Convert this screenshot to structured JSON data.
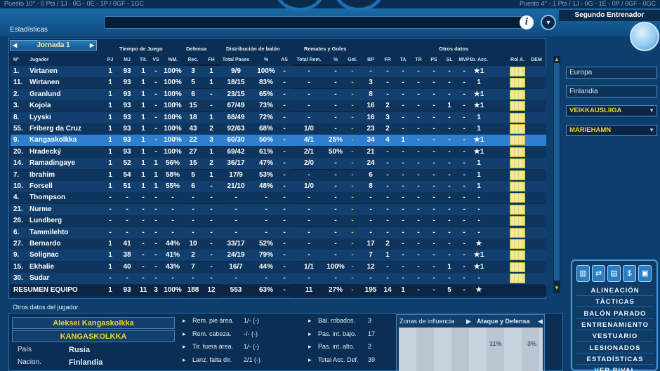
{
  "top_strip": {
    "left": "Puesto 10° - 0 Pts / 1J - 0G - 0E - 1P / 0GF - 1GC",
    "right": "Puesto 4° - 1 Pts / 1J - 0G - 1E - 0P / 0GF - 0GC"
  },
  "header": {
    "section_title": "Estadísticas",
    "assistant_label": "Segundo Entrenador",
    "info_button": "i"
  },
  "jornada": {
    "label": "Jornada 1"
  },
  "column_groups": {
    "tiempo": "Tiempo de Juego",
    "defensa": "Defensa",
    "distribucion": "Distribución de balón",
    "remates": "Remates y Goles",
    "otros": "Otros datos"
  },
  "columns": {
    "n": "Nº",
    "jugador": "Jugador",
    "pj": "PJ",
    "mj": "MJ",
    "tit": "Tit.",
    "vs": "VS",
    "pm": "%M.",
    "rec": "Rec.",
    "fh": "FH",
    "tp": "Total Pases",
    "pp": "%",
    "as": "AS",
    "tr": "Total Rem.",
    "rp": "%",
    "gol": "Gol.",
    "bp": "BP",
    "fr": "FR",
    "ta": "TA",
    "trr": "TR",
    "ps": "PS",
    "sl": "SL",
    "mvp": "MVP",
    "bra": "Br. Acc.",
    "rol": "Rol A.",
    "dem": "DEM"
  },
  "rows": [
    {
      "n": "1.",
      "name": "Virtanen",
      "pj": "1",
      "mj": "93",
      "tit": "1",
      "vs": "-",
      "pm": "100%",
      "rec": "3",
      "fh": "1",
      "tp": "9/9",
      "pp": "100%",
      "as": "-",
      "tr": "-",
      "rp": "-",
      "gol": "-",
      "bp": "-",
      "fr": "-",
      "ta": "-",
      "trr": "-",
      "ps": "-",
      "sl": "-",
      "mvp": "-",
      "bra": "★1"
    },
    {
      "n": "11.",
      "name": "Wirtanen",
      "pj": "1",
      "mj": "93",
      "tit": "1",
      "vs": "-",
      "pm": "100%",
      "rec": "5",
      "fh": "1",
      "tp": "18/15",
      "pp": "83%",
      "as": "-",
      "tr": "-",
      "rp": "-",
      "gol": "-",
      "bp": "3",
      "fr": "-",
      "ta": "-",
      "trr": "-",
      "ps": "-",
      "sl": "-",
      "mvp": "-",
      "bra": "1"
    },
    {
      "n": "2.",
      "name": "Granlund",
      "pj": "1",
      "mj": "93",
      "tit": "1",
      "vs": "-",
      "pm": "100%",
      "rec": "6",
      "fh": "-",
      "tp": "23/15",
      "pp": "65%",
      "as": "-",
      "tr": "-",
      "rp": "-",
      "gol": "-",
      "bp": "8",
      "fr": "-",
      "ta": "-",
      "trr": "-",
      "ps": "-",
      "sl": "-",
      "mvp": "-",
      "bra": "★1"
    },
    {
      "n": "3.",
      "name": "Kojola",
      "pj": "1",
      "mj": "93",
      "tit": "1",
      "vs": "-",
      "pm": "100%",
      "rec": "15",
      "fh": "-",
      "tp": "67/49",
      "pp": "73%",
      "as": "-",
      "tr": "-",
      "rp": "-",
      "gol": "-",
      "bp": "16",
      "fr": "2",
      "ta": "-",
      "trr": "-",
      "ps": "-",
      "sl": "1",
      "mvp": "-",
      "bra": "★1"
    },
    {
      "n": "8.",
      "name": "Lyyski",
      "pj": "1",
      "mj": "93",
      "tit": "1",
      "vs": "-",
      "pm": "100%",
      "rec": "18",
      "fh": "1",
      "tp": "68/49",
      "pp": "72%",
      "as": "-",
      "tr": "-",
      "rp": "-",
      "gol": "-",
      "bp": "16",
      "fr": "3",
      "ta": "-",
      "trr": "-",
      "ps": "-",
      "sl": "-",
      "mvp": "-",
      "bra": "1"
    },
    {
      "n": "55.",
      "name": "Friberg da Cruz",
      "pj": "1",
      "mj": "93",
      "tit": "1",
      "vs": "-",
      "pm": "100%",
      "rec": "43",
      "fh": "2",
      "tp": "92/63",
      "pp": "68%",
      "as": "-",
      "tr": "1/0",
      "rp": "-",
      "gol": "-",
      "bp": "23",
      "fr": "2",
      "ta": "-",
      "trr": "-",
      "ps": "-",
      "sl": "-",
      "mvp": "-",
      "bra": "1"
    },
    {
      "n": "9.",
      "name": "Kangaskolkka",
      "pj": "1",
      "mj": "93",
      "tit": "1",
      "vs": "-",
      "pm": "100%",
      "rec": "22",
      "fh": "3",
      "tp": "60/30",
      "pp": "50%",
      "as": "-",
      "tr": "4/1",
      "rp": "25%",
      "gol": "-",
      "bp": "34",
      "fr": "4",
      "ta": "1",
      "trr": "-",
      "ps": "-",
      "sl": "-",
      "mvp": "-",
      "bra": "★1",
      "sel": true
    },
    {
      "n": "20.",
      "name": "Hradecký",
      "pj": "1",
      "mj": "93",
      "tit": "1",
      "vs": "-",
      "pm": "100%",
      "rec": "27",
      "fh": "1",
      "tp": "69/42",
      "pp": "61%",
      "as": "-",
      "tr": "2/1",
      "rp": "50%",
      "gol": "-",
      "bp": "21",
      "fr": "-",
      "ta": "-",
      "trr": "-",
      "ps": "-",
      "sl": "-",
      "mvp": "-",
      "bra": "★1"
    },
    {
      "n": "14.",
      "name": "Ramadingaye",
      "pj": "1",
      "mj": "52",
      "tit": "1",
      "vs": "1",
      "pm": "56%",
      "rec": "15",
      "fh": "2",
      "tp": "36/17",
      "pp": "47%",
      "as": "-",
      "tr": "2/0",
      "rp": "-",
      "gol": "-",
      "bp": "24",
      "fr": "-",
      "ta": "-",
      "trr": "-",
      "ps": "-",
      "sl": "-",
      "mvp": "-",
      "bra": "1"
    },
    {
      "n": "7.",
      "name": "Ibrahim",
      "pj": "1",
      "mj": "54",
      "tit": "1",
      "vs": "1",
      "pm": "58%",
      "rec": "5",
      "fh": "1",
      "tp": "17/9",
      "pp": "53%",
      "as": "-",
      "tr": "-",
      "rp": "-",
      "gol": "-",
      "bp": "6",
      "fr": "-",
      "ta": "-",
      "trr": "-",
      "ps": "-",
      "sl": "-",
      "mvp": "-",
      "bra": "1"
    },
    {
      "n": "10.",
      "name": "Forsell",
      "pj": "1",
      "mj": "51",
      "tit": "1",
      "vs": "1",
      "pm": "55%",
      "rec": "6",
      "fh": "-",
      "tp": "21/10",
      "pp": "48%",
      "as": "-",
      "tr": "1/0",
      "rp": "-",
      "gol": "-",
      "bp": "8",
      "fr": "-",
      "ta": "-",
      "trr": "-",
      "ps": "-",
      "sl": "-",
      "mvp": "-",
      "bra": "1"
    },
    {
      "n": "4.",
      "name": "Thompson",
      "pj": "-",
      "mj": "-",
      "tit": "-",
      "vs": "-",
      "pm": "-",
      "rec": "-",
      "fh": "-",
      "tp": "-",
      "pp": "-",
      "as": "-",
      "tr": "-",
      "rp": "-",
      "gol": "-",
      "bp": "-",
      "fr": "-",
      "ta": "-",
      "trr": "-",
      "ps": "-",
      "sl": "-",
      "mvp": "-",
      "bra": "-"
    },
    {
      "n": "21.",
      "name": "Nurme",
      "pj": "-",
      "mj": "-",
      "tit": "-",
      "vs": "-",
      "pm": "-",
      "rec": "-",
      "fh": "-",
      "tp": "-",
      "pp": "-",
      "as": "-",
      "tr": "-",
      "rp": "-",
      "gol": "-",
      "bp": "-",
      "fr": "-",
      "ta": "-",
      "trr": "-",
      "ps": "-",
      "sl": "-",
      "mvp": "-",
      "bra": "-"
    },
    {
      "n": "26.",
      "name": "Lundberg",
      "pj": "-",
      "mj": "-",
      "tit": "-",
      "vs": "-",
      "pm": "-",
      "rec": "-",
      "fh": "-",
      "tp": "-",
      "pp": "-",
      "as": "-",
      "tr": "-",
      "rp": "-",
      "gol": "-",
      "bp": "-",
      "fr": "-",
      "ta": "-",
      "trr": "-",
      "ps": "-",
      "sl": "-",
      "mvp": "-",
      "bra": "-"
    },
    {
      "n": "6.",
      "name": "Tammilehto",
      "pj": "-",
      "mj": "-",
      "tit": "-",
      "vs": "-",
      "pm": "-",
      "rec": "-",
      "fh": "-",
      "tp": "-",
      "pp": "-",
      "as": "-",
      "tr": "-",
      "rp": "-",
      "gol": "-",
      "bp": "-",
      "fr": "-",
      "ta": "-",
      "trr": "-",
      "ps": "-",
      "sl": "-",
      "mvp": "-",
      "bra": "-"
    },
    {
      "n": "27.",
      "name": "Bernardo",
      "pj": "1",
      "mj": "41",
      "tit": "-",
      "vs": "-",
      "pm": "44%",
      "rec": "10",
      "fh": "-",
      "tp": "33/17",
      "pp": "52%",
      "as": "-",
      "tr": "-",
      "rp": "-",
      "gol": "-",
      "bp": "17",
      "fr": "2",
      "ta": "-",
      "trr": "-",
      "ps": "-",
      "sl": "-",
      "mvp": "-",
      "bra": "★"
    },
    {
      "n": "9.",
      "name": "Solignac",
      "pj": "1",
      "mj": "38",
      "tit": "-",
      "vs": "-",
      "pm": "41%",
      "rec": "2",
      "fh": "-",
      "tp": "24/19",
      "pp": "79%",
      "as": "-",
      "tr": "-",
      "rp": "-",
      "gol": "-",
      "bp": "7",
      "fr": "1",
      "ta": "-",
      "trr": "-",
      "ps": "-",
      "sl": "-",
      "mvp": "-",
      "bra": "★1"
    },
    {
      "n": "15.",
      "name": "Ekhalie",
      "pj": "1",
      "mj": "40",
      "tit": "-",
      "vs": "-",
      "pm": "43%",
      "rec": "7",
      "fh": "-",
      "tp": "16/7",
      "pp": "44%",
      "as": "-",
      "tr": "1/1",
      "rp": "100%",
      "gol": "-",
      "bp": "12",
      "fr": "-",
      "ta": "-",
      "trr": "-",
      "ps": "-",
      "sl": "1",
      "mvp": "-",
      "bra": "★1"
    },
    {
      "n": "30.",
      "name": "Sudar",
      "pj": "-",
      "mj": "-",
      "tit": "-",
      "vs": "-",
      "pm": "-",
      "rec": "-",
      "fh": "-",
      "tp": "-",
      "pp": "-",
      "as": "-",
      "tr": "-",
      "rp": "-",
      "gol": "-",
      "bp": "-",
      "fr": "-",
      "ta": "-",
      "trr": "-",
      "ps": "-",
      "sl": "-",
      "mvp": "-",
      "bra": "-"
    }
  ],
  "summary": {
    "name": "RESUMEN EQUIPO",
    "pj": "1",
    "mj": "93",
    "tit": "11",
    "vs": "3",
    "pm": "100%",
    "rec": "188",
    "fh": "12",
    "tp": "553",
    "pp": "63%",
    "as": "-",
    "tr": "11",
    "rp": "27%",
    "gol": "-",
    "bp": "195",
    "fr": "14",
    "ta": "1",
    "trr": "-",
    "ps": "-",
    "sl": "5",
    "mvp": "-",
    "bra": "★"
  },
  "sidebar": {
    "competition": "Europa",
    "country": "Finlandia",
    "league": "VEIKKAUSLIIGA",
    "team": "MARIEHAMN"
  },
  "menu": {
    "items": [
      "ALINEACIÓN",
      "TÁCTICAS",
      "BALÓN PARADO",
      "ENTRENAMIENTO",
      "VESTUARIO",
      "LESIONADOS",
      "ESTADÍSTICAS",
      "VER RIVAL"
    ]
  },
  "player_panel": {
    "section_label": "Otros datos del jugador.",
    "full_name": "Aleksei Kangaskolkka",
    "short_name": "KANGASKOLKKA",
    "pais_label": "País",
    "pais": "Rusia",
    "nacion_label": "Nacion.",
    "nacion": "Finlandia",
    "stats_a": [
      {
        "label": "Rem. pie área.",
        "value": "1/-  (-)"
      },
      {
        "label": "Rem. cabeza.",
        "value": "-/-  (-)"
      },
      {
        "label": "Tir. fuera área.",
        "value": "1/-  (-)"
      },
      {
        "label": "Lanz. falta dir.",
        "value": "2/1  (-)"
      }
    ],
    "stats_b": [
      {
        "label": "Bal. robados.",
        "value": "3"
      },
      {
        "label": "Pas. int. bajo.",
        "value": "17"
      },
      {
        "label": "Pas. int. alto.",
        "value": "2"
      },
      {
        "label": "Total Acc. Def.",
        "value": "39"
      }
    ],
    "zonas_label": "Zonas de influencia",
    "zonas_mode": "Ataque y Defensa",
    "zonas_pct_a": "11%",
    "zonas_pct_b": "3%"
  },
  "colors": {
    "selected_row": "#2f7fd0",
    "accent": "#e6c12a"
  }
}
